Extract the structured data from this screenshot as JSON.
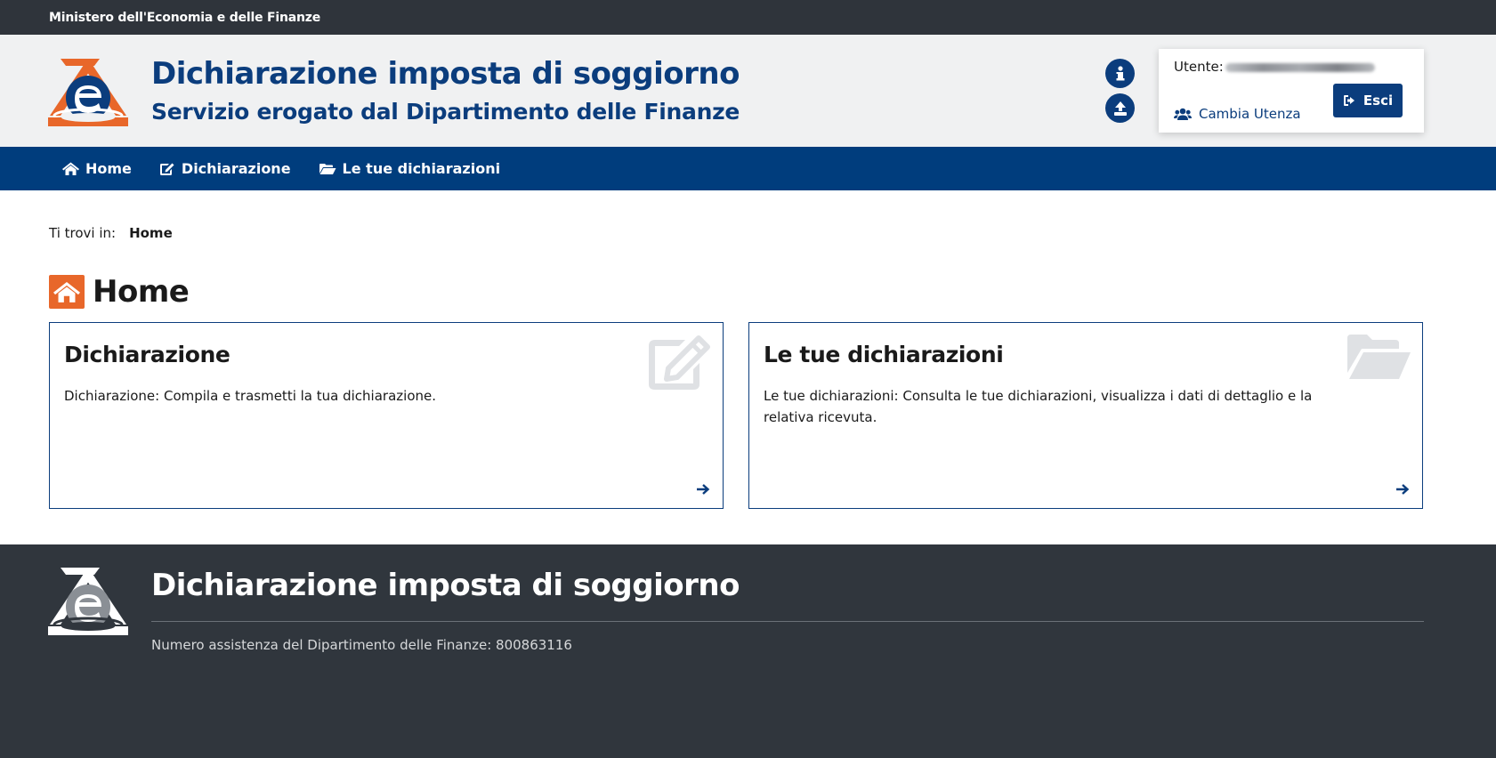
{
  "topbar": {
    "ministry": "Ministero dell'Economia e delle Finanze"
  },
  "header": {
    "title": "Dichiarazione imposta di soggiorno",
    "subtitle": "Servizio erogato dal Dipartimento delle Finanze",
    "logo_icon": "agenzia-e-logo-icon",
    "info_icon": "info-icon",
    "upload_icon": "upload-icon"
  },
  "user": {
    "label": "Utente:",
    "change_label": "Cambia Utenza",
    "logout_label": "Esci"
  },
  "nav": {
    "items": [
      {
        "label": "Home",
        "icon": "home-icon"
      },
      {
        "label": "Dichiarazione",
        "icon": "edit-icon"
      },
      {
        "label": "Le tue dichiarazioni",
        "icon": "folder-open-icon"
      }
    ]
  },
  "breadcrumb": {
    "prefix": "Ti trovi in:",
    "current": "Home"
  },
  "page": {
    "title": "Home"
  },
  "cards": [
    {
      "title": "Dichiarazione",
      "text": "Dichiarazione: Compila e trasmetti la tua dichiarazione.",
      "icon": "edit-icon"
    },
    {
      "title": "Le tue dichiarazioni",
      "text": "Le tue dichiarazioni: Consulta le tue dichiarazioni, visualizza i dati di dettaglio e la relativa ricevuta.",
      "icon": "folder-open-icon"
    }
  ],
  "footer": {
    "title": "Dichiarazione imposta di soggiorno",
    "assistance": "Numero assistenza del Dipartimento delle Finanze: 800863116"
  },
  "colors": {
    "primary": "#0b3d7d",
    "nav_bg": "#003d7d",
    "accent_orange": "#e8672a",
    "topbar_bg": "#2f343b",
    "footer_bg": "#30363d",
    "header_bg": "#f0f1f2"
  }
}
